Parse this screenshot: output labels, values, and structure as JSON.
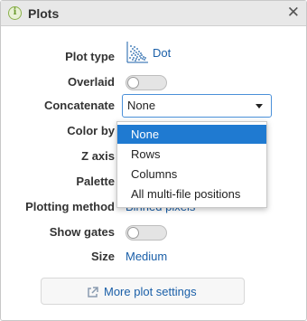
{
  "header": {
    "title": "Plots",
    "info_icon": "info-icon",
    "close_glyph": "✕"
  },
  "fields": {
    "plot_type": {
      "label": "Plot type",
      "value": "Dot"
    },
    "overlaid": {
      "label": "Overlaid",
      "on": false
    },
    "concatenate": {
      "label": "Concatenate",
      "value": "None"
    },
    "color_by": {
      "label": "Color by"
    },
    "z_axis": {
      "label": "Z axis"
    },
    "palette": {
      "label": "Palette"
    },
    "plotting_method": {
      "label": "Plotting method",
      "value": "Binned pixels"
    },
    "show_gates": {
      "label": "Show gates",
      "on": false
    },
    "size": {
      "label": "Size",
      "value": "Medium"
    }
  },
  "dropdown": {
    "options": [
      "None",
      "Rows",
      "Columns",
      "All multi-file positions"
    ],
    "selected": "None"
  },
  "more_button": {
    "label": "More plot settings"
  },
  "colors": {
    "accent": "#1f7ad1",
    "link": "#1a5fa8",
    "focus_border": "#4a90d9"
  }
}
